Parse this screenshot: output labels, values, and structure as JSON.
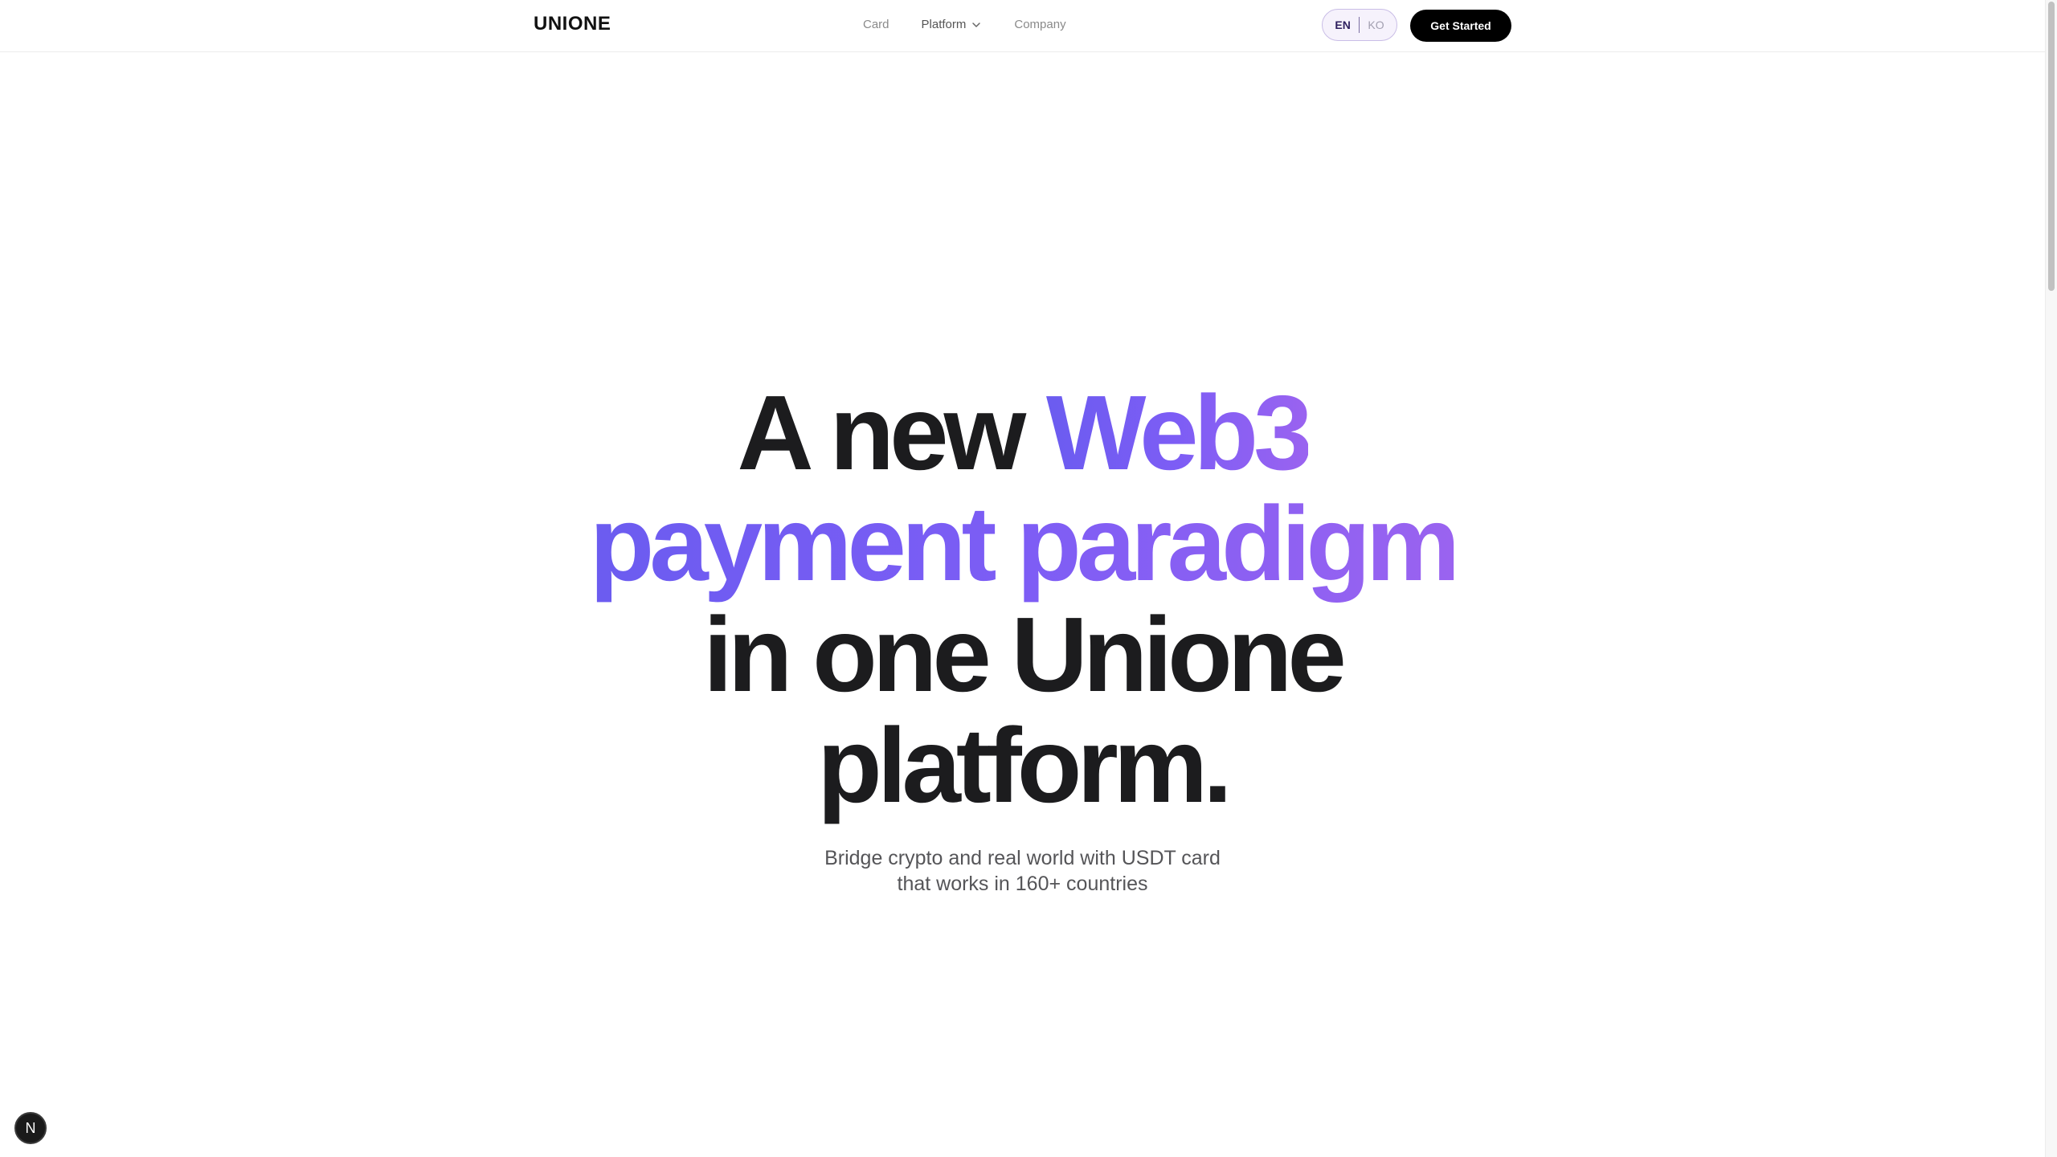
{
  "header": {
    "logo": "UNIONE",
    "nav": {
      "card": "Card",
      "platform": "Platform",
      "company": "Company"
    },
    "lang": {
      "en": "EN",
      "ko": "KO"
    },
    "cta_label": "Get Started"
  },
  "hero": {
    "line1_plain": "A new ",
    "line1_accent": "Web3",
    "line2_accent": "payment paradigm",
    "line3": "in one Unione",
    "line4": "platform.",
    "subtitle_line1": "Bridge crypto and real world with USDT card",
    "subtitle_line2": "that works in 160+ countries"
  },
  "dev_badge": {
    "label": "N"
  },
  "colors": {
    "accent_start": "#6b5cf0",
    "accent_end": "#9a63f0",
    "cta_bg": "#000000",
    "lang_border": "#c9bde6"
  },
  "icons": {
    "platform_dropdown": "chevron-down-icon",
    "dev_badge": "nextjs-logo-icon"
  }
}
